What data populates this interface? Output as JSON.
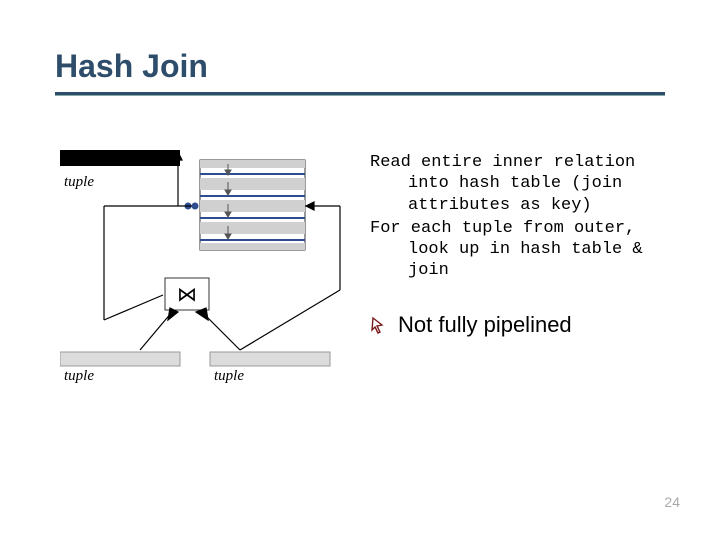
{
  "title": "Hash Join",
  "diagram": {
    "tuple_label_left": "tuple",
    "tuple_label_bottom_left": "tuple",
    "tuple_label_bottom_right": "tuple",
    "join_symbol": "⋈"
  },
  "body": {
    "para1": "Read entire inner relation into hash table (join attributes as key)",
    "para2": "For each tuple from outer, look up in hash table & join"
  },
  "bullet": {
    "icon_name": "pointer-icon",
    "text": "Not fully pipelined"
  },
  "page_number": "24"
}
